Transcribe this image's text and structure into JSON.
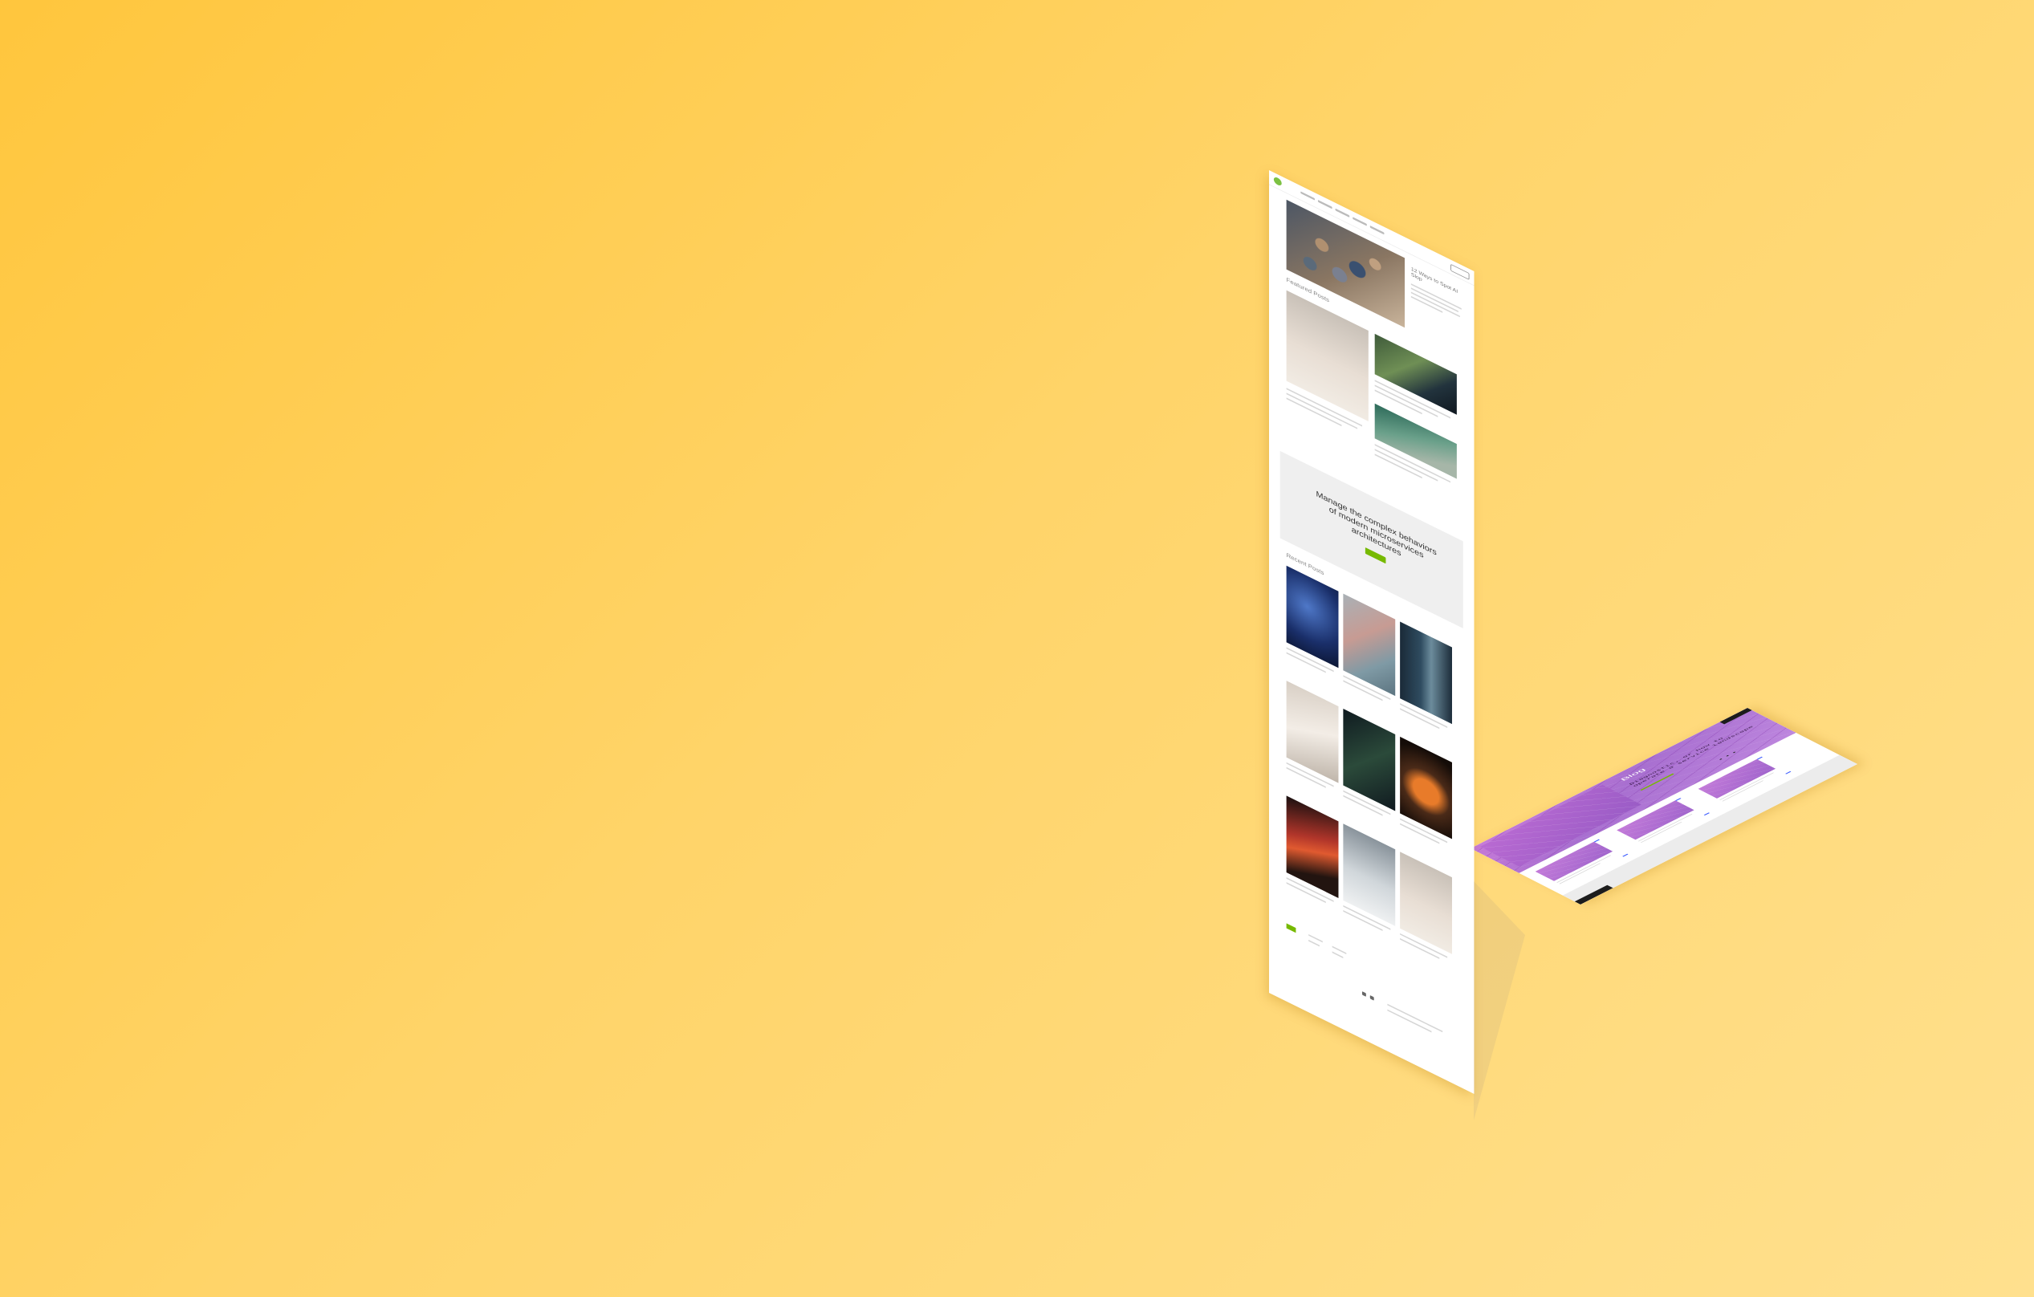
{
  "vertical_page": {
    "hero_title": "12 Ways to Spot AI Slop",
    "featured_heading": "Featured Posts",
    "banner_text": "Manage the complex behaviors of modern microservices architectures",
    "recent_heading": "Recent Posts"
  },
  "floor_page": {
    "blog_label": "Blog",
    "tagline": "Diagnostic, or how to operate a service landscape",
    "dots": "• • •"
  },
  "colors": {
    "background_start": "#ffc63d",
    "background_end": "#ffe08e",
    "accent_green": "#76b900",
    "hero_purple": "#b673d5",
    "marker_blue": "#3a5bff"
  }
}
